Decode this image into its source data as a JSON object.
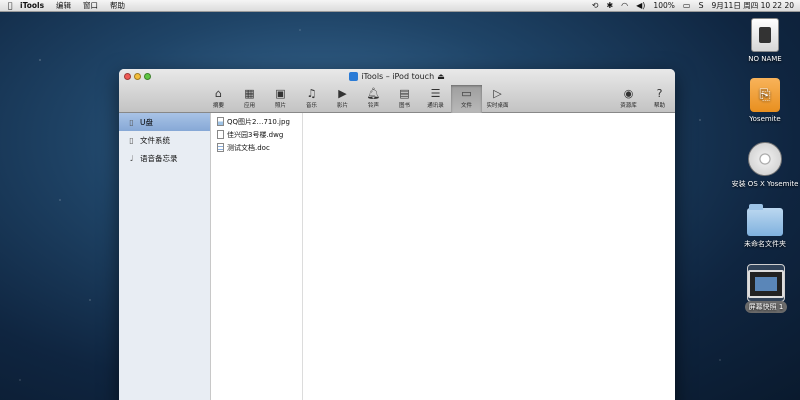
{
  "menubar": {
    "apple_icon": "apple-icon",
    "app_name": "iTools",
    "menus": [
      "编辑",
      "窗口",
      "帮助"
    ],
    "battery": "100%",
    "datetime": "9月11日 周四 10 22 20"
  },
  "desktop_icons": [
    {
      "label": "NO NAME",
      "icon": "hard-drive-icon"
    },
    {
      "label": "Yosemite",
      "icon": "usb-drive-icon"
    },
    {
      "label": "安装 OS X Yosemite",
      "icon": "installer-disc-icon"
    },
    {
      "label": "未命名文件夹",
      "icon": "folder-icon"
    },
    {
      "label": "屏幕快照 1",
      "icon": "screenshot-icon"
    }
  ],
  "window": {
    "title": "iTools – iPod touch",
    "toolbar": [
      {
        "label": "摘要",
        "icon": "home-icon"
      },
      {
        "label": "应用",
        "icon": "apps-icon"
      },
      {
        "label": "照片",
        "icon": "photo-icon"
      },
      {
        "label": "音乐",
        "icon": "music-icon"
      },
      {
        "label": "影片",
        "icon": "video-icon"
      },
      {
        "label": "铃声",
        "icon": "bell-icon"
      },
      {
        "label": "图书",
        "icon": "book-icon"
      },
      {
        "label": "通讯录",
        "icon": "contacts-icon"
      },
      {
        "label": "文件",
        "icon": "folder-icon"
      },
      {
        "label": "实时桌面",
        "icon": "play-icon"
      }
    ],
    "toolbar_right": [
      {
        "label": "资源库",
        "icon": "globe-icon"
      },
      {
        "label": "帮助",
        "icon": "help-icon"
      }
    ],
    "sidebar": [
      {
        "label": "U盘",
        "icon": "usb-icon"
      },
      {
        "label": "文件系统",
        "icon": "phone-icon"
      },
      {
        "label": "语音备忘录",
        "icon": "microphone-icon"
      }
    ],
    "files": [
      {
        "name": "QQ图片2…710.jpg",
        "type": "image"
      },
      {
        "name": "佳兴园3号楼.dwg",
        "type": "drawing"
      },
      {
        "name": "测试文档.doc",
        "type": "document"
      }
    ]
  }
}
